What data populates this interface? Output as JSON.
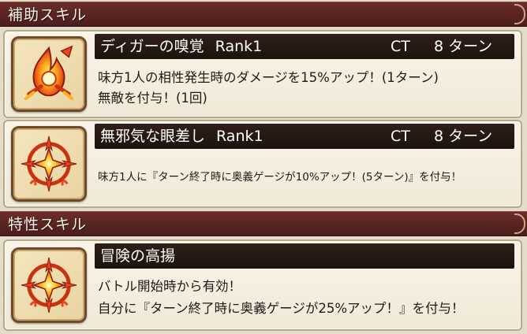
{
  "support_section": {
    "title": "補助スキル",
    "skills": [
      {
        "name": "ディガーの嗅覚",
        "rank": "Rank1",
        "ct_label": "CT",
        "ct_value": "8 ターン",
        "description": [
          "味方1人の相性発生時のダメージを15%アップ！(1ターン)",
          "無敵を付与！(1回)"
        ],
        "icon": "flame-sword-skill-icon"
      },
      {
        "name": "無邪気な眼差し",
        "rank": "Rank1",
        "ct_label": "CT",
        "ct_value": "8 ターン",
        "description": [
          "味方1人に『ターン終了時に奥義ゲージが10%アップ！(5ターン)』を付与！"
        ],
        "icon": "fire-emblem-skill-icon"
      }
    ]
  },
  "trait_section": {
    "title": "特性スキル",
    "skills": [
      {
        "name": "冒険の高揚",
        "description": [
          "バトル開始時から有効！",
          "自分に『ターン終了時に奥義ゲージが25%アップ！』を付与！"
        ],
        "icon": "fire-emblem-skill-icon"
      }
    ]
  },
  "colors": {
    "header_bg": "#5a2522",
    "card_bg": "#f6f0e2",
    "name_bar_bg": "#241812",
    "icon_fire": "#e8461e",
    "icon_glow": "#ffd23a"
  }
}
